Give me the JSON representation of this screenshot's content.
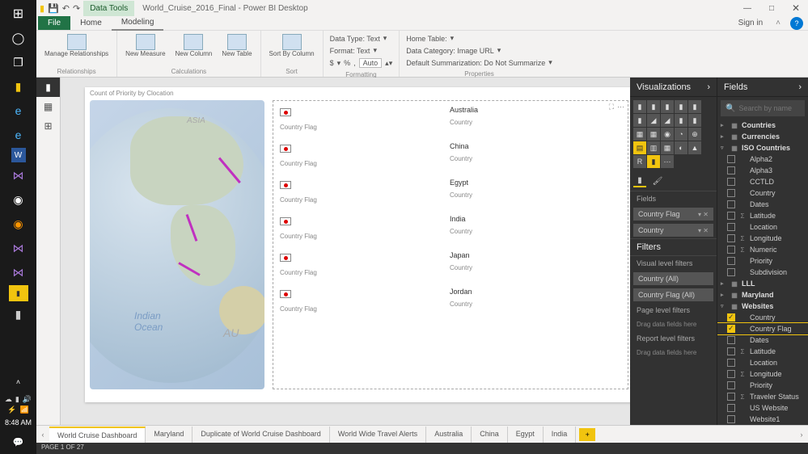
{
  "clock": "8:48 AM",
  "title": {
    "tab": "Data Tools",
    "file": "World_Cruise_2016_Final - Power BI Desktop"
  },
  "win_buttons": {
    "min": "—",
    "max": "□",
    "close": "✕"
  },
  "ribbon_tabs": {
    "file": "File",
    "home": "Home",
    "modeling": "Modeling",
    "signin": "Sign in"
  },
  "ribbon": {
    "relationships": {
      "manage": "Manage\nRelationships",
      "label": "Relationships"
    },
    "calculations": {
      "measure": "New\nMeasure",
      "column": "New\nColumn",
      "table": "New\nTable",
      "label": "Calculations"
    },
    "sort": {
      "sortby": "Sort By\nColumn",
      "label": "Sort"
    },
    "formatting": {
      "datatype": "Data Type: Text",
      "format": "Format: Text",
      "currency": "$",
      "percent": "%",
      "comma": ",",
      "auto": "Auto",
      "label": "Formatting"
    },
    "properties": {
      "hometable": "Home Table:",
      "datacat": "Data Category: Image URL",
      "summ": "Default Summarization: Do Not Summarize",
      "label": "Properties"
    }
  },
  "canvas": {
    "maptitle": "Count of Priority by Clocation",
    "ocean": "Indian\nOcean",
    "asia": "ASIA",
    "au": "AU",
    "list": [
      {
        "name": "Australia",
        "type": "Country",
        "flaglbl": "Country Flag"
      },
      {
        "name": "China",
        "type": "Country",
        "flaglbl": "Country Flag"
      },
      {
        "name": "Egypt",
        "type": "Country",
        "flaglbl": "Country Flag"
      },
      {
        "name": "India",
        "type": "Country",
        "flaglbl": "Country Flag"
      },
      {
        "name": "Japan",
        "type": "Country",
        "flaglbl": "Country Flag"
      },
      {
        "name": "Jordan",
        "type": "Country",
        "flaglbl": "Country Flag"
      }
    ]
  },
  "pages": {
    "tabs": [
      "World Cruise Dashboard",
      "Maryland",
      "Duplicate of World Cruise Dashboard",
      "World Wide Travel Alerts",
      "Australia",
      "China",
      "Egypt",
      "India"
    ],
    "active": 0,
    "status": "PAGE 1 OF 27"
  },
  "viz": {
    "head": "Visualizations",
    "tabs_fields": "Fields",
    "wells": [
      "Country Flag",
      "Country"
    ],
    "filters_head": "Filters",
    "vlf": "Visual level filters",
    "filters": [
      "Country (All)",
      "Country Flag (All)"
    ],
    "plf": "Page level filters",
    "rlf": "Report level filters",
    "drop": "Drag data fields here"
  },
  "fields": {
    "head": "Fields",
    "search_ph": "Search by name",
    "items": [
      {
        "t": "table",
        "exp": "▸",
        "name": "Countries"
      },
      {
        "t": "table",
        "exp": "▸",
        "name": "Currencies"
      },
      {
        "t": "table",
        "exp": "▿",
        "name": "ISO Countries"
      },
      {
        "t": "field",
        "name": "Alpha2"
      },
      {
        "t": "field",
        "name": "Alpha3"
      },
      {
        "t": "field",
        "name": "CCTLD"
      },
      {
        "t": "field",
        "name": "Country"
      },
      {
        "t": "field",
        "name": "Dates"
      },
      {
        "t": "field",
        "ic": "Σ",
        "name": "Latitude"
      },
      {
        "t": "field",
        "name": "Location"
      },
      {
        "t": "field",
        "ic": "Σ",
        "name": "Longitude"
      },
      {
        "t": "field",
        "ic": "Σ",
        "name": "Numeric"
      },
      {
        "t": "field",
        "name": "Priority"
      },
      {
        "t": "field",
        "name": "Subdivision"
      },
      {
        "t": "table",
        "exp": "▸",
        "name": "LLL"
      },
      {
        "t": "table",
        "exp": "▸",
        "name": "Maryland"
      },
      {
        "t": "table",
        "exp": "▿",
        "name": "Websites"
      },
      {
        "t": "field",
        "checked": true,
        "name": "Country"
      },
      {
        "t": "field",
        "checked": true,
        "hl": true,
        "name": "Country Flag"
      },
      {
        "t": "field",
        "name": "Dates"
      },
      {
        "t": "field",
        "ic": "Σ",
        "name": "Latitude"
      },
      {
        "t": "field",
        "name": "Location"
      },
      {
        "t": "field",
        "ic": "Σ",
        "name": "Longitude"
      },
      {
        "t": "field",
        "name": "Priority"
      },
      {
        "t": "field",
        "ic": "Σ",
        "name": "Traveler Status"
      },
      {
        "t": "field",
        "name": "US Website"
      },
      {
        "t": "field",
        "name": "Website1"
      }
    ]
  }
}
